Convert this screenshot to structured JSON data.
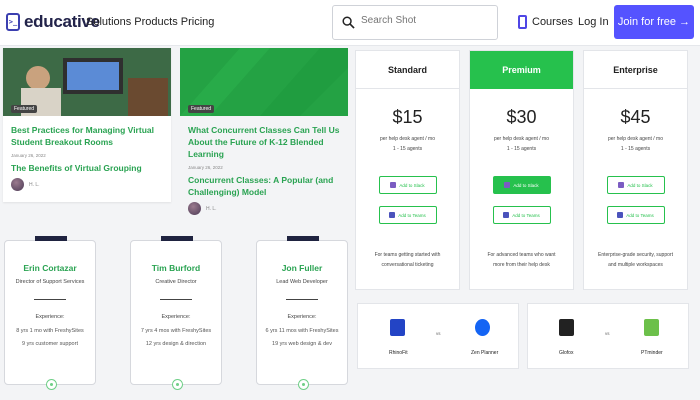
{
  "header": {
    "brand": "educative",
    "brand_icon": "terminal-logo-icon",
    "nav": "Solutions Products Pricing",
    "search_placeholder": "Search Shot",
    "courses": "Courses",
    "login": "Log In",
    "join": "Join for free →",
    "accent_color": "#5553ff"
  },
  "blogs": [
    {
      "tag": "Featured",
      "title": "Best Practices for Managing Virtual Student Breakout Rooms",
      "date": "January 26, 2022",
      "subtitle": "The Benefits of Virtual Grouping",
      "author": "H. L."
    },
    {
      "tag": "Featured",
      "title": "What Concurrent Classes Can Tell Us About the Future of K-12 Blended Learning",
      "date": "January 26, 2022",
      "subtitle": "Concurrent Classes: A Popular (and Challenging) Model",
      "author": "H. L."
    }
  ],
  "plans": [
    {
      "name": "Standard",
      "price": "$15",
      "per": "per help desk agent / mo",
      "agents": "1 - 15 agents",
      "slack": "Add to Slack",
      "teams": "Add to Teams",
      "desc": "For teams getting started with conversational ticketing"
    },
    {
      "name": "Premium",
      "price": "$30",
      "per": "per help desk agent / mo",
      "agents": "1 - 15 agents",
      "slack": "Add to Slack",
      "teams": "Add to Teams",
      "desc": "For advanced teams who want more from their help desk"
    },
    {
      "name": "Enterprise",
      "price": "$45",
      "per": "per help desk agent / mo",
      "agents": "1 - 15 agents",
      "slack": "Add to Slack",
      "teams": "Add to Teams",
      "desc": "Enterprise-grade security, support and multiple workspaces"
    }
  ],
  "team": [
    {
      "name": "Erin Cortazar",
      "role": "Director of Support Services",
      "exp_label": "Experience:",
      "exp1": "8 yrs 1 mo with FreshySites",
      "exp2": "9 yrs customer support"
    },
    {
      "name": "Tim Burford",
      "role": "Creative Director",
      "exp_label": "Experience:",
      "exp1": "7 yrs 4 mos with FreshySites",
      "exp2": "12 yrs design & direction"
    },
    {
      "name": "Jon Fuller",
      "role": "Lead Web Developer",
      "exp_label": "Experience:",
      "exp1": "6 yrs 11 mos with FreshySites",
      "exp2": "19 yrs web design & dev"
    }
  ],
  "comparisons": [
    {
      "left": "RhinoFit",
      "vs": "vs",
      "right": "Zen Planner",
      "left_color": "#2344c5",
      "right_color": "#1464f4"
    },
    {
      "left": "Glofox",
      "vs": "vs",
      "right": "PTminder",
      "left_color": "#222222",
      "right_color": "#6cc04a"
    }
  ]
}
